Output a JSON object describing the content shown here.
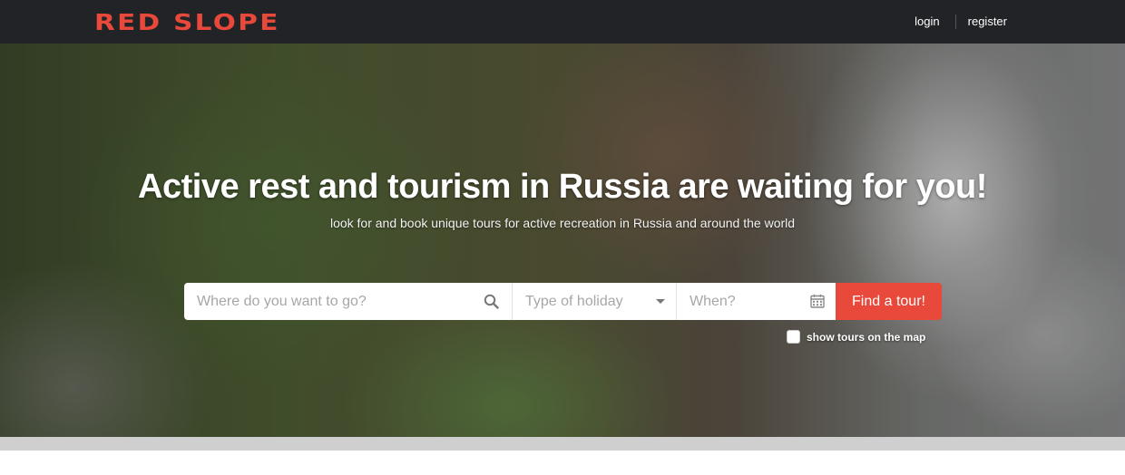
{
  "header": {
    "logo": "RED SLOPE",
    "nav": {
      "login": "login",
      "register": "register"
    }
  },
  "hero": {
    "headline": "Active rest and tourism in Russia are waiting for you!",
    "subline": "look for and book unique tours for active recreation in Russia and around the world"
  },
  "search": {
    "where_placeholder": "Where do you want to go?",
    "type_placeholder": "Type of holiday",
    "when_placeholder": "When?",
    "button_label": "Find a tour!",
    "map_toggle_label": "show tours on the map",
    "map_toggle_checked": false
  },
  "colors": {
    "accent": "#e8493b",
    "header_bg": "#222326"
  },
  "icons": {
    "where": "search-icon",
    "type": "chevron-down-icon",
    "when": "calendar-icon"
  }
}
